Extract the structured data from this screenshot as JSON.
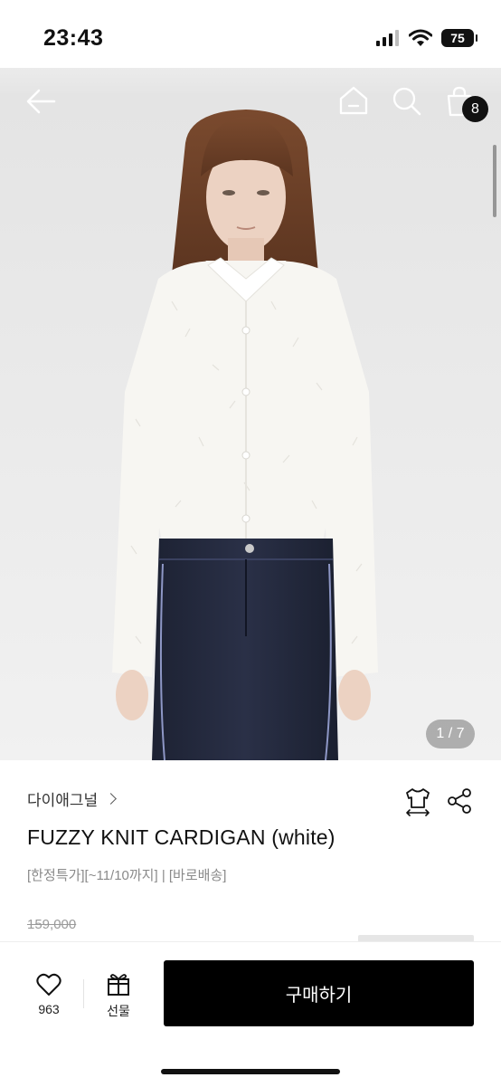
{
  "status_bar": {
    "time": "23:43",
    "battery": "75"
  },
  "nav": {
    "cart_count": "8"
  },
  "gallery": {
    "indicator": "1 / 7"
  },
  "product": {
    "brand": "다이애그널",
    "title": "FUZZY KNIT CARDIGAN (white)",
    "tags": "[한정특가][~11/10까지] | [바로배송]",
    "original_price": "159,000"
  },
  "actions": {
    "like_count": "963",
    "gift_label": "선물",
    "buy_label": "구매하기"
  },
  "icons": {
    "back": "arrow-left-icon",
    "home": "home-icon",
    "search": "search-icon",
    "cart": "shopping-bag-icon",
    "size": "tshirt-size-icon",
    "share": "share-icon",
    "like": "heart-icon",
    "gift": "gift-icon"
  },
  "colors": {
    "buy_button": "#000000",
    "accent_text": "#111111",
    "muted_text": "#8a8a8a"
  }
}
